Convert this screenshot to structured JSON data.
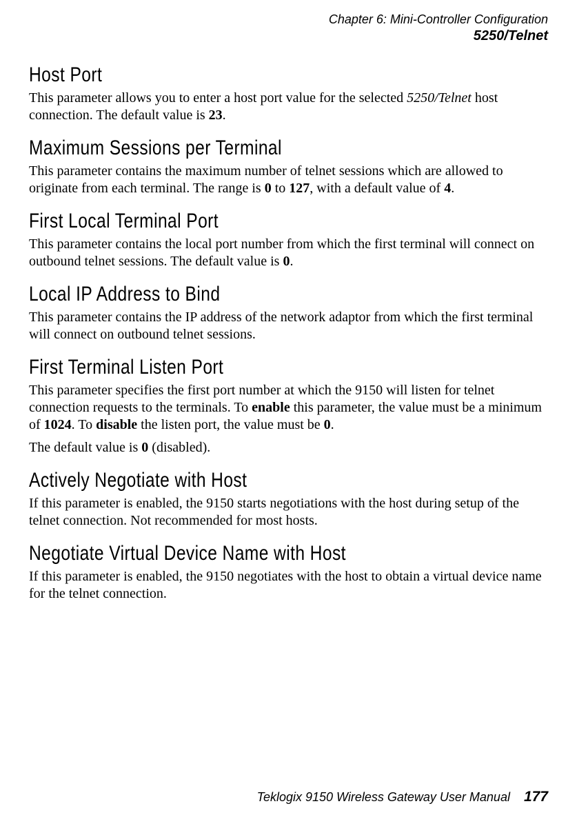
{
  "header": {
    "chapter": "Chapter 6:  Mini-Controller Configuration",
    "section": "5250/Telnet"
  },
  "sections": {
    "hostPort": {
      "title": "Host Port",
      "p1a": "This parameter allows you to enter a host port value for the selected ",
      "p1b": "5250/Telnet",
      "p1c": " host connection. The default value is ",
      "p1d": "23",
      "p1e": "."
    },
    "maxSessions": {
      "title": "Maximum Sessions per Terminal",
      "p1a": "This parameter contains the maximum number of telnet sessions which are allowed to originate from each terminal. The range is ",
      "p1b": "0",
      "p1c": " to ",
      "p1d": "127",
      "p1e": ", with a default value of ",
      "p1f": "4",
      "p1g": "."
    },
    "firstLocal": {
      "title": "First Local Terminal Port",
      "p1a": "This parameter contains the local port number from which the first terminal will connect on outbound telnet sessions. The default value is ",
      "p1b": "0",
      "p1c": "."
    },
    "localIp": {
      "title": "Local IP Address to Bind",
      "p1": "This parameter contains the IP address of the network adaptor from which the first terminal will connect on outbound telnet sessions."
    },
    "listenPort": {
      "title": "First Terminal Listen Port",
      "p1a": "This parameter specifies the first port number at which the 9150 will listen for telnet connection requests to the terminals. To ",
      "p1b": "enable",
      "p1c": " this parameter, the value must be a minimum of ",
      "p1d": "1024",
      "p1e": ". To ",
      "p1f": "disable",
      "p1g": " the listen port, the value must be ",
      "p1h": "0",
      "p1i": ".",
      "p2a": "The default value is ",
      "p2b": "0",
      "p2c": " (disabled)."
    },
    "actively": {
      "title": "Actively Negotiate with Host",
      "p1": "If this parameter is enabled, the 9150 starts negotiations with the host during setup of the telnet connection. Not recommended for most hosts."
    },
    "negotiate": {
      "title": "Negotiate Virtual Device Name with Host",
      "p1": "If this parameter is enabled, the 9150 negotiates with the host to obtain a virtual device name for the telnet connection."
    }
  },
  "footer": {
    "manual": "Teklogix 9150 Wireless Gateway User Manual",
    "page": "177"
  }
}
